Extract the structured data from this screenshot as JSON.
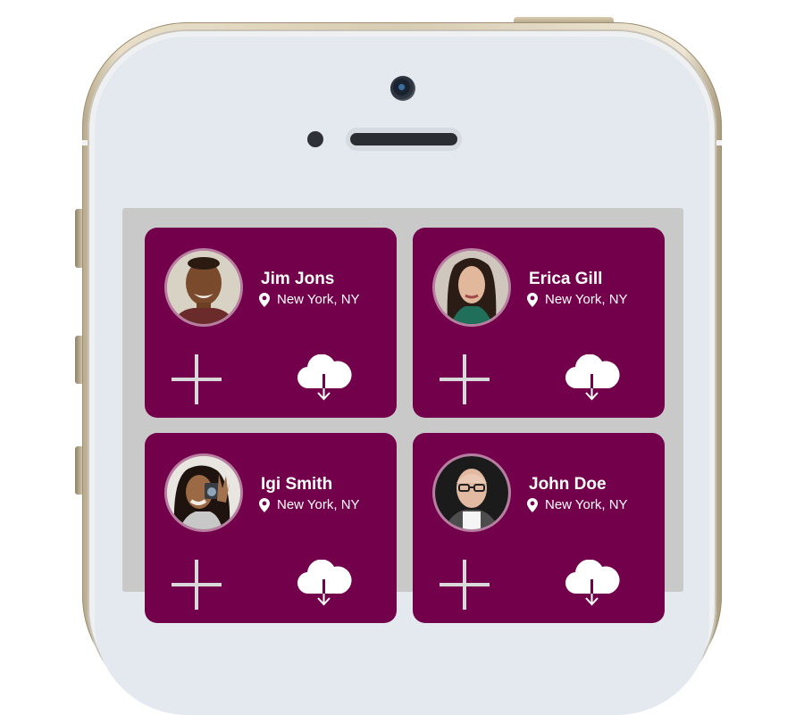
{
  "device": {
    "type": "phone mockup"
  },
  "contacts": [
    {
      "name": "Jim Jons",
      "location": "New York, NY",
      "photo": "avatar-man-smiling"
    },
    {
      "name": "Erica Gill",
      "location": "New York, NY",
      "photo": "avatar-woman-dark-hair"
    },
    {
      "name": "Igi Smith",
      "location": "New York, NY",
      "photo": "avatar-woman-camera"
    },
    {
      "name": "John Doe",
      "location": "New York, NY",
      "photo": "avatar-man-glasses"
    }
  ],
  "icons": {
    "location": "map-pin-icon",
    "add": "plus-icon",
    "download": "cloud-download-icon"
  },
  "colors": {
    "card": "#72004a",
    "avatar_ring": "#b77ea0",
    "screen_bg": "#c9c9c9",
    "text": "#ffffff"
  }
}
